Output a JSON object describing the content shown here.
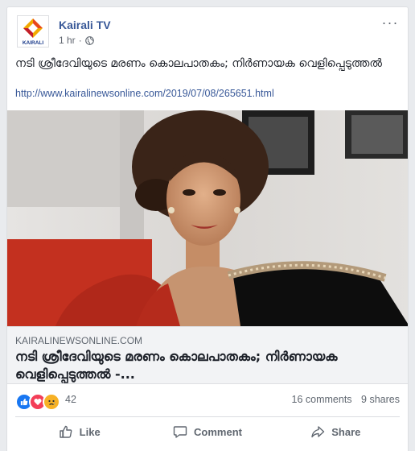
{
  "post": {
    "page_name": "Kairali TV",
    "time": "1 hr",
    "privacy_icon": "globe-icon",
    "more_icon": "more-icon",
    "text": "നടി ശ്രീദേവിയുടെ മരണം കൊലപാതകം; നിര്‍ണായക വെളിപ്പെടുത്തല്‍",
    "link": "http://www.kairalinewsonline.com/2019/07/08/265651.html",
    "avatar_text": "KAIRALI"
  },
  "link_preview": {
    "domain": "KAIRALINEWSONLINE.COM",
    "title": "നടി ശ്രീദേവിയുടെ മരണം കൊലപാതകം; നിര്‍ണായക വെളിപ്പെടുത്തല്‍ -..."
  },
  "reactions": {
    "icons": [
      "like-reaction-icon",
      "love-reaction-icon",
      "sad-reaction-icon"
    ],
    "count": "42",
    "comments": "16 comments",
    "shares": "9 shares"
  },
  "actions": {
    "like": "Like",
    "comment": "Comment",
    "share": "Share"
  },
  "colors": {
    "link": "#385898",
    "like_blue": "#1877f2",
    "love_red": "#f33e58",
    "sad_yellow": "#f7b125"
  }
}
